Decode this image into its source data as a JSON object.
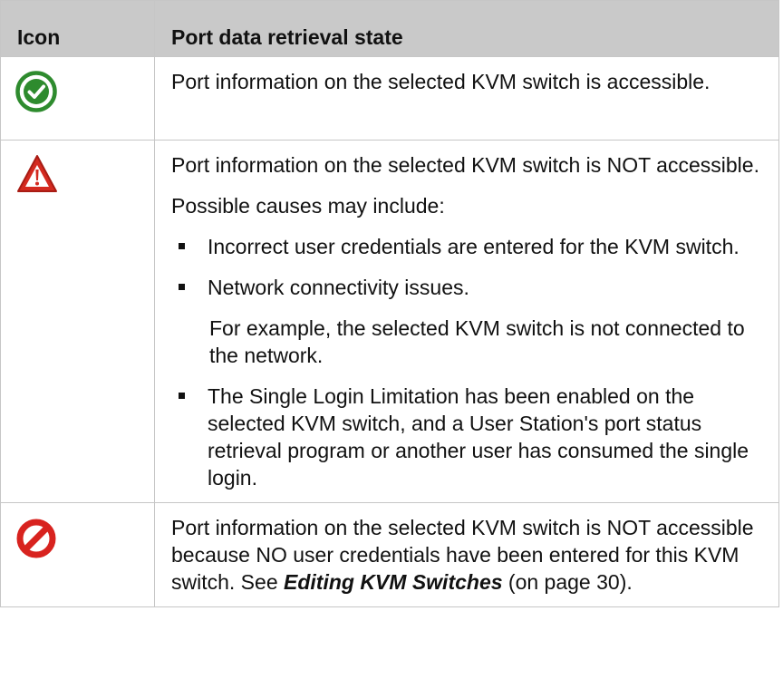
{
  "table": {
    "headers": [
      "Icon",
      "Port data retrieval state"
    ],
    "rows": [
      {
        "icon": "green-checkmark-circle-icon",
        "text": "Port information on the selected KVM switch is accessible."
      },
      {
        "icon": "red-warning-triangle-icon",
        "text": "Port information on the selected KVM switch is NOT accessible.",
        "causes_intro": "Possible causes may include:",
        "causes": [
          "Incorrect user credentials are entered for the KVM switch.",
          "Network connectivity issues.",
          "The Single Login Limitation has been enabled on the selected KVM switch, and a User Station's port status retrieval program or another user has consumed the single login."
        ],
        "cause_note": "For example, the selected KVM switch is not connected to the network."
      },
      {
        "icon": "red-prohibited-icon",
        "text_before_link": "Port information on the selected KVM switch is NOT accessible because NO user credentials have been entered for this KVM switch. See ",
        "link": "Editing KVM Switches",
        "text_after_link": " (on page 30)."
      }
    ]
  },
  "colors": {
    "header_bg": "#c9c9c9",
    "border": "#c6c6c6",
    "check_green": "#2e8b2e",
    "warning_red": "#d42a20",
    "prohibit_red": "#d8231f"
  }
}
